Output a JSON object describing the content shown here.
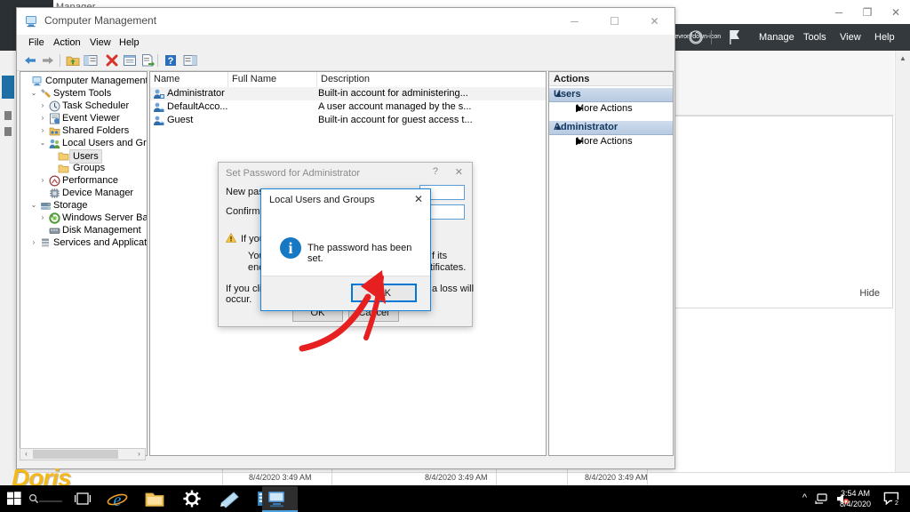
{
  "server_manager": {
    "title": "Server Manager",
    "app_icon": "server-manager-icon",
    "window_controls": {
      "minimize": "─",
      "maximize": "❐",
      "close": "✕"
    },
    "menu": {
      "refresh_icon": "refresh-icon",
      "dropdown_icon": "chevron-down-icon",
      "flag_icon": "notifications-flag-icon",
      "items": [
        "Manage",
        "Tools",
        "View",
        "Help"
      ]
    },
    "tile": {
      "hide_label": "Hide"
    },
    "status_timestamps": [
      "8/4/2020 3:49 AM",
      "8/4/2020 3:49 AM",
      "8/4/2020 3:49 AM"
    ]
  },
  "computer_management": {
    "title": "Computer Management",
    "icon": "computer-management-icon",
    "window_controls": {
      "minimize": "─",
      "maximize": "☐",
      "close": "✕"
    },
    "menu": [
      "File",
      "Action",
      "View",
      "Help"
    ],
    "toolbar": [
      {
        "name": "back-icon",
        "glyph": "←"
      },
      {
        "name": "forward-icon",
        "glyph": "→"
      },
      {
        "name": "up-folder-icon",
        "glyph": "↑"
      },
      {
        "name": "show-hide-console-tree-icon",
        "glyph": "▤"
      },
      {
        "name": "delete-icon",
        "glyph": "✕"
      },
      {
        "name": "properties-icon",
        "glyph": "▥"
      },
      {
        "name": "export-list-icon",
        "glyph": "↴"
      },
      {
        "name": "help-icon",
        "glyph": "?"
      },
      {
        "name": "show-hide-action-pane-icon",
        "glyph": "▤"
      }
    ],
    "tree": [
      {
        "label": "Computer Management (Local",
        "depth": 0,
        "twisty": "",
        "icon": "computer-icon",
        "selected": false
      },
      {
        "label": "System Tools",
        "depth": 1,
        "twisty": "⌄",
        "icon": "system-tools-icon",
        "selected": false
      },
      {
        "label": "Task Scheduler",
        "depth": 2,
        "twisty": "›",
        "icon": "clock-icon",
        "selected": false
      },
      {
        "label": "Event Viewer",
        "depth": 2,
        "twisty": "›",
        "icon": "event-viewer-icon",
        "selected": false
      },
      {
        "label": "Shared Folders",
        "depth": 2,
        "twisty": "›",
        "icon": "shared-folders-icon",
        "selected": false
      },
      {
        "label": "Local Users and Groups",
        "depth": 2,
        "twisty": "⌄",
        "icon": "users-groups-icon",
        "selected": false
      },
      {
        "label": "Users",
        "depth": 3,
        "twisty": "",
        "icon": "folder-icon",
        "selected": true
      },
      {
        "label": "Groups",
        "depth": 3,
        "twisty": "",
        "icon": "folder-icon",
        "selected": false
      },
      {
        "label": "Performance",
        "depth": 2,
        "twisty": "›",
        "icon": "performance-icon",
        "selected": false
      },
      {
        "label": "Device Manager",
        "depth": 2,
        "twisty": "",
        "icon": "device-manager-icon",
        "selected": false
      },
      {
        "label": "Storage",
        "depth": 1,
        "twisty": "⌄",
        "icon": "storage-icon",
        "selected": false
      },
      {
        "label": "Windows Server Backup",
        "depth": 2,
        "twisty": "›",
        "icon": "backup-icon",
        "selected": false
      },
      {
        "label": "Disk Management",
        "depth": 2,
        "twisty": "",
        "icon": "disk-icon",
        "selected": false
      },
      {
        "label": "Services and Applications",
        "depth": 1,
        "twisty": "›",
        "icon": "services-icon",
        "selected": false
      }
    ],
    "list": {
      "columns": [
        "Name",
        "Full Name",
        "Description"
      ],
      "rows": [
        {
          "icon": "user-admin-icon",
          "name": "Administrator",
          "full_name": "",
          "description": "Built-in account for administering...",
          "selected": true
        },
        {
          "icon": "user-icon",
          "name": "DefaultAcco...",
          "full_name": "",
          "description": "A user account managed by the s...",
          "selected": false
        },
        {
          "icon": "user-icon",
          "name": "Guest",
          "full_name": "",
          "description": "Built-in account for guest access t...",
          "selected": false
        }
      ]
    },
    "actions": {
      "header": "Actions",
      "groups": [
        {
          "title": "Users",
          "items": [
            {
              "label": "More Actions",
              "arrow": "▶"
            }
          ]
        },
        {
          "title": "Administrator",
          "items": [
            {
              "label": "More Actions",
              "arrow": "▶"
            }
          ]
        }
      ],
      "collapse_glyph": "▲"
    },
    "hscroll": {
      "left": "‹",
      "right": "›"
    }
  },
  "set_password_dialog": {
    "title": "Set Password for Administrator",
    "help_glyph": "?",
    "close_glyph": "✕",
    "labels": {
      "new_password": "New passw",
      "confirm_password": "Confirm pas"
    },
    "fields": {
      "new_password_value": "",
      "confirm_password_value": ""
    },
    "warning_icon": "warning-triangle-icon",
    "warning_lines": [
      "If you",
      "Your l",
      "encryp",
      "f its",
      "tificates."
    ],
    "note_lines": [
      "If you click",
      "occur.",
      "a loss will"
    ],
    "buttons": {
      "ok": "OK",
      "cancel": "Cancel"
    }
  },
  "message_box": {
    "title": "Local Users and Groups",
    "close_glyph": "✕",
    "icon": "information-icon",
    "icon_glyph": "i",
    "message": "The password has been set.",
    "ok_label": "OK"
  },
  "annotation": {
    "arrow_color": "#e62020"
  },
  "watermark": {
    "text": "Doris",
    "color": "#f5b81b"
  },
  "taskbar": {
    "start_icon": "windows-start-icon",
    "search_placeholder": "",
    "task_view_icon": "task-view-icon",
    "pinned": [
      {
        "name": "internet-explorer-icon",
        "glyph": "e"
      },
      {
        "name": "file-explorer-icon",
        "glyph": "▤"
      },
      {
        "name": "settings-gear-icon",
        "glyph": "⚙"
      },
      {
        "name": "notepad-icon",
        "glyph": "▱"
      },
      {
        "name": "server-manager-taskbar-icon",
        "glyph": "▥"
      },
      {
        "name": "computer-management-taskbar-icon",
        "glyph": "▦"
      }
    ],
    "tray": {
      "show_hidden_icons": "^",
      "network_icon": "network-icon",
      "volume_icon": "volume-muted-icon",
      "time": "3:54 AM",
      "date": "8/4/2020",
      "action_center_icon": "action-center-icon",
      "notification_count": "2"
    }
  },
  "colors": {
    "accent_blue": "#0078d7",
    "dark_chrome": "#33393d",
    "actions_group": "#c3d3e6",
    "arrow_red": "#e62020",
    "watermark_yellow": "#f5b81b"
  }
}
